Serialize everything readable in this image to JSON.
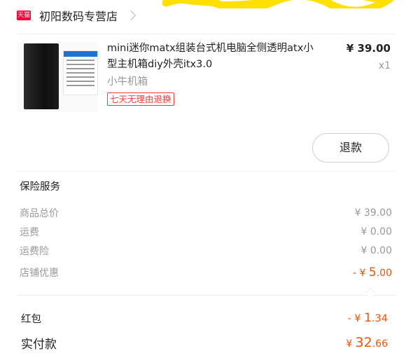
{
  "store": {
    "badge": "天猫",
    "name": "初阳数码专营店"
  },
  "product": {
    "title": "mini迷你matx组装台式机电脑全侧透明atx小型主机箱diy外壳itx3.0",
    "sku": "小牛机箱",
    "tag": "七天无理由退换",
    "price": "¥ 39.00",
    "qty": "x1",
    "refund_label": "退款"
  },
  "insurance_title": "保险服务",
  "fees": {
    "goods_total": {
      "label": "商品总价",
      "value": "¥ 39.00"
    },
    "shipping": {
      "label": "运费",
      "value": "¥ 0.00"
    },
    "shipping_insurance": {
      "label": "运费险",
      "value": "¥ 0.00"
    },
    "store_discount": {
      "label": "店铺优惠",
      "prefix": "- ¥ ",
      "amount_int": "5",
      "amount_dec": ".00"
    }
  },
  "red_packet": {
    "label": "红包",
    "prefix": "- ¥ ",
    "amount_int": "1",
    "amount_dec": ".34"
  },
  "paid": {
    "label": "实付款",
    "prefix": "¥ ",
    "amount_int": "32",
    "amount_dec": ".66"
  },
  "colors": {
    "accent": "#ff5000",
    "tag_red": "#ff3b3b",
    "tmall_red": "#ff0036",
    "scribble_yellow": "#ffe000"
  }
}
